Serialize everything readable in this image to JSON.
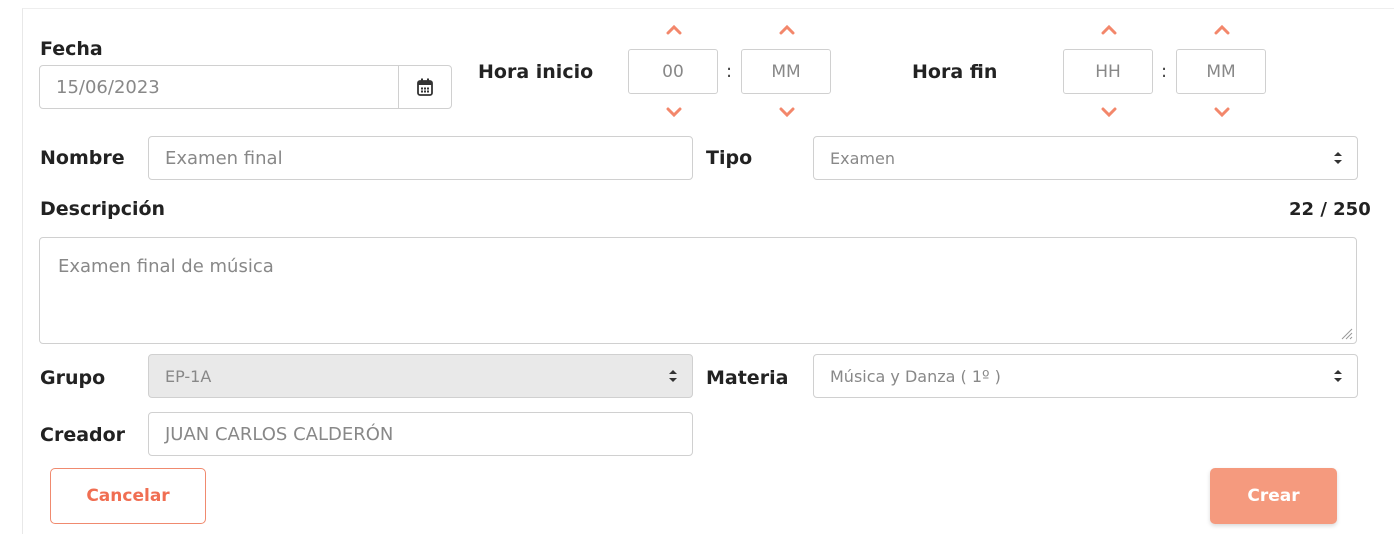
{
  "colors": {
    "accent": "#f06e52",
    "accent_light": "#f59a7e",
    "border": "#d0d0d0",
    "disabled_bg": "#e9e9e9"
  },
  "fecha": {
    "label": "Fecha",
    "value": "15/06/2023",
    "icon": "calendar-icon"
  },
  "hora_inicio": {
    "label": "Hora inicio",
    "hours": "00",
    "minutes": "MM",
    "separator": ":"
  },
  "hora_fin": {
    "label": "Hora fin",
    "hours": "HH",
    "minutes": "MM",
    "separator": ":"
  },
  "nombre": {
    "label": "Nombre",
    "value": "Examen final"
  },
  "tipo": {
    "label": "Tipo",
    "value": "Examen"
  },
  "descripcion": {
    "label": "Descripción",
    "value": "Examen final de música",
    "counter": "22 / 250"
  },
  "grupo": {
    "label": "Grupo",
    "value": "EP-1A"
  },
  "materia": {
    "label": "Materia",
    "value": "Música y Danza ( 1º )"
  },
  "creador": {
    "label": "Creador",
    "value": "JUAN CARLOS CALDERÓN"
  },
  "actions": {
    "cancel": "Cancelar",
    "create": "Crear"
  }
}
